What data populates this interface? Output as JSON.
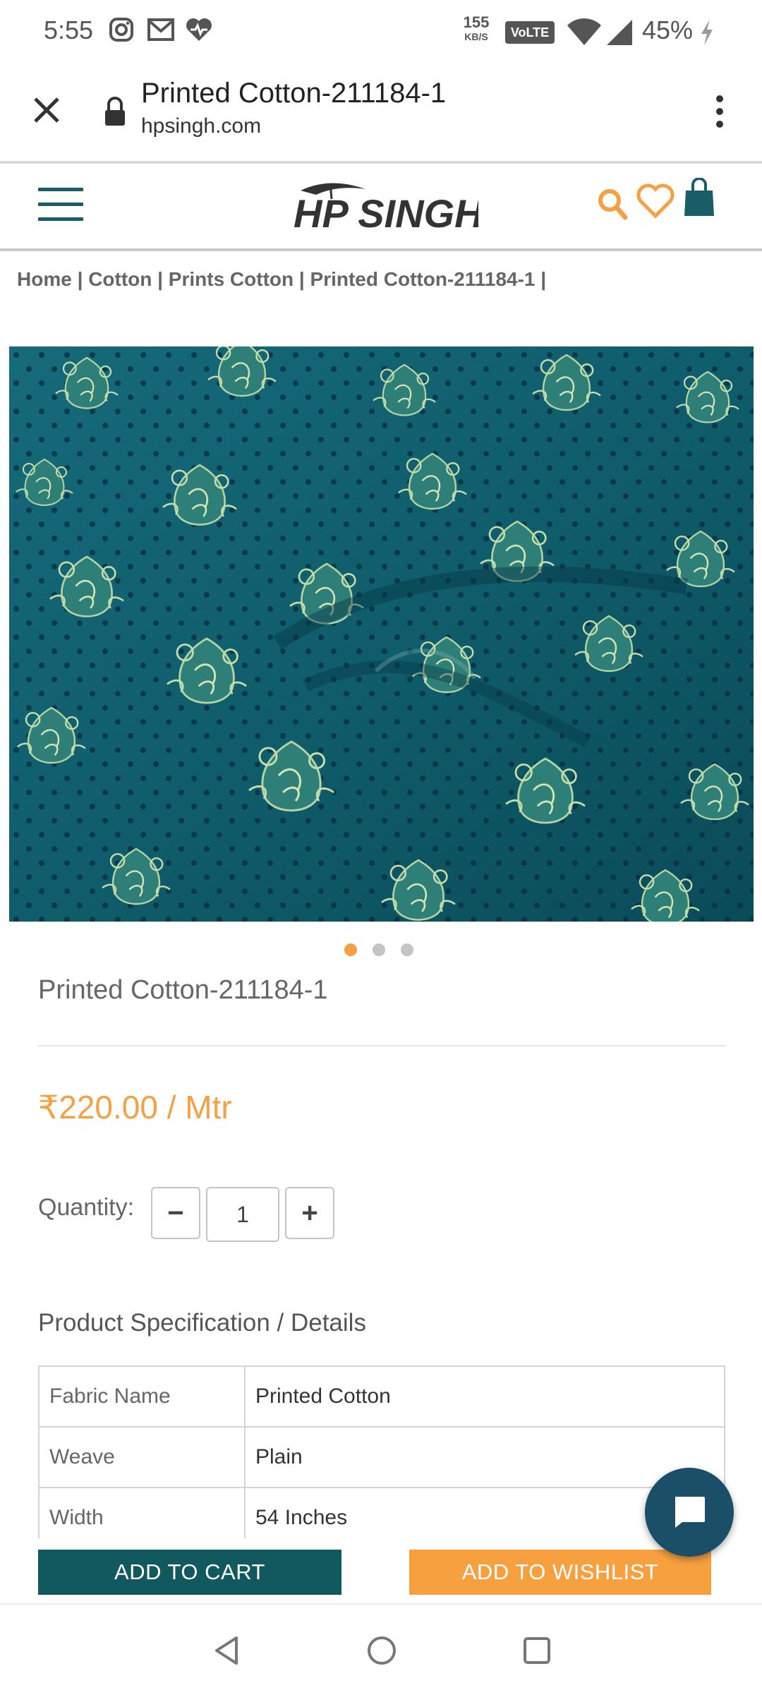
{
  "status_bar": {
    "time": "5:55",
    "speed_value": "155",
    "speed_unit": "KB/S",
    "network_badge": "VoLTE",
    "battery": "45%",
    "icons": [
      "instagram-icon",
      "gmail-icon",
      "heart-app-icon",
      "wifi-icon",
      "signal-icon",
      "charging-icon"
    ]
  },
  "browser": {
    "page_title": "Printed Cotton-211184-1",
    "url": "hpsingh.com"
  },
  "header": {
    "logo_text": "HP SINGH",
    "brand_color": "#195d66",
    "accent_color": "#f5a045"
  },
  "breadcrumb": {
    "items": [
      "Home",
      "Cotton",
      "Prints Cotton",
      "Printed Cotton-211184-1"
    ]
  },
  "product": {
    "title": "Printed Cotton-211184-1",
    "price": "₹220.00 / Mtr",
    "quantity_label": "Quantity:",
    "quantity_value": "1",
    "minus": "−",
    "plus": "+",
    "carousel_active": 1,
    "carousel_count": 3
  },
  "specs": {
    "heading": "Product Specification / Details",
    "rows": [
      {
        "key": "Fabric Name",
        "value": "Printed Cotton"
      },
      {
        "key": "Weave",
        "value": "Plain"
      },
      {
        "key": "Width",
        "value": "54 Inches"
      }
    ]
  },
  "actions": {
    "add_to_cart": "ADD TO CART",
    "add_to_wishlist": "ADD TO WISHLIST"
  }
}
